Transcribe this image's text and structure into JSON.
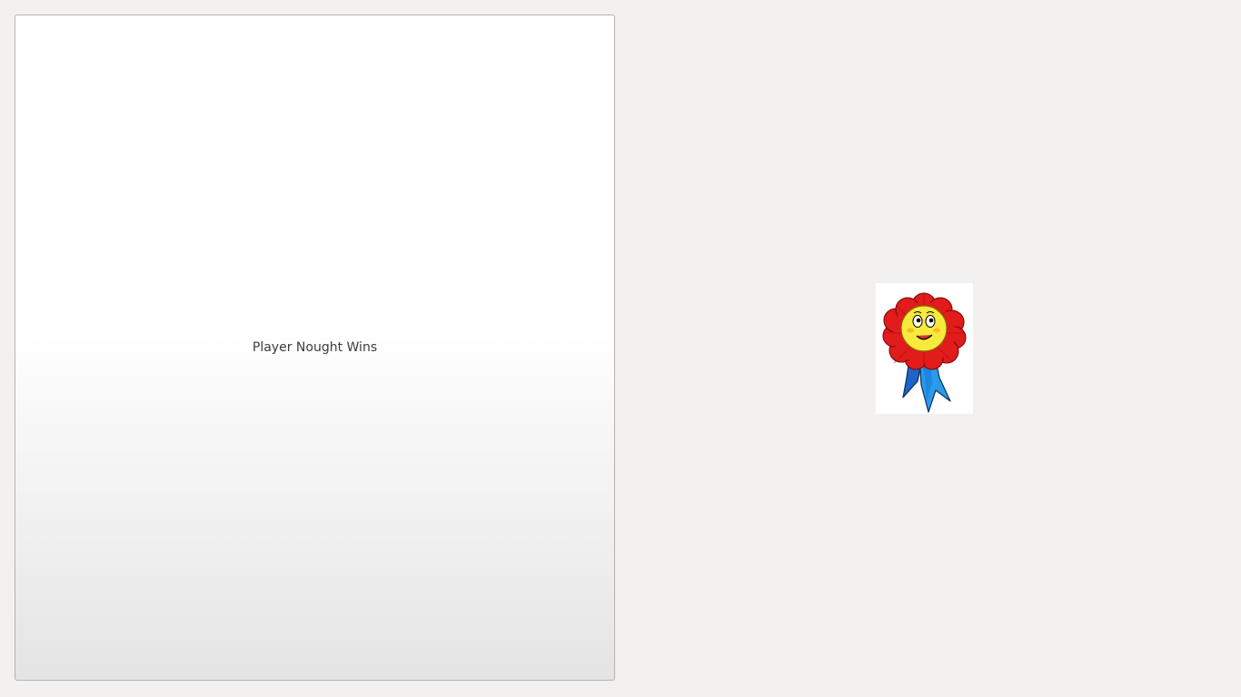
{
  "game": {
    "result_text": "Player Nought Wins"
  },
  "winner_image": {
    "icon": "award-rosette-icon",
    "colors": {
      "petals": "#e21b1b",
      "face": "#f7ea3c",
      "ribbon": "#1e7fd8"
    }
  }
}
